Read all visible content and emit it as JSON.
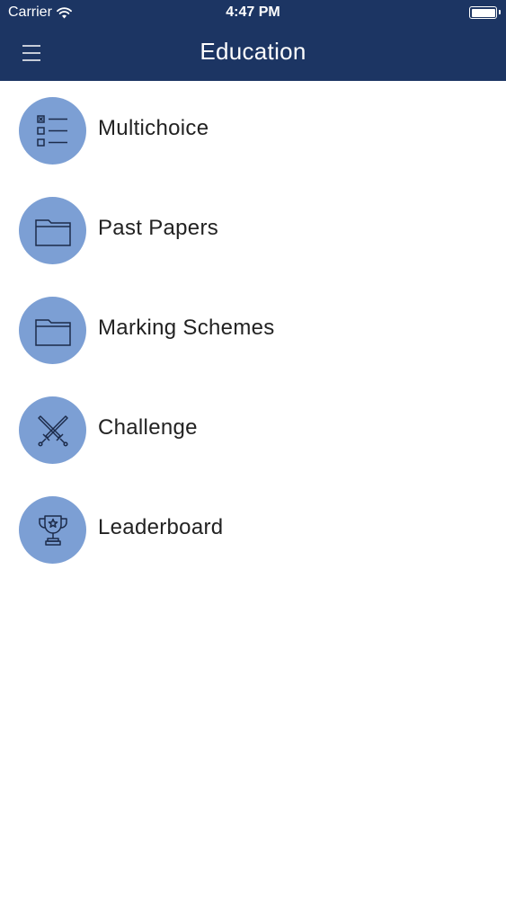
{
  "status_bar": {
    "carrier": "Carrier",
    "time": "4:47 PM"
  },
  "nav": {
    "title": "Education",
    "menu_icon": "hamburger-menu-icon"
  },
  "colors": {
    "header_bg": "#1c3563",
    "icon_circle": "#7c9fd4",
    "icon_stroke": "#1c2b4a",
    "label_text": "#222222"
  },
  "menu": {
    "items": [
      {
        "label": "Multichoice",
        "icon": "checklist-icon"
      },
      {
        "label": "Past Papers",
        "icon": "folder-icon"
      },
      {
        "label": "Marking Schemes",
        "icon": "folder-icon"
      },
      {
        "label": "Challenge",
        "icon": "crossed-swords-icon"
      },
      {
        "label": "Leaderboard",
        "icon": "trophy-icon"
      }
    ]
  }
}
